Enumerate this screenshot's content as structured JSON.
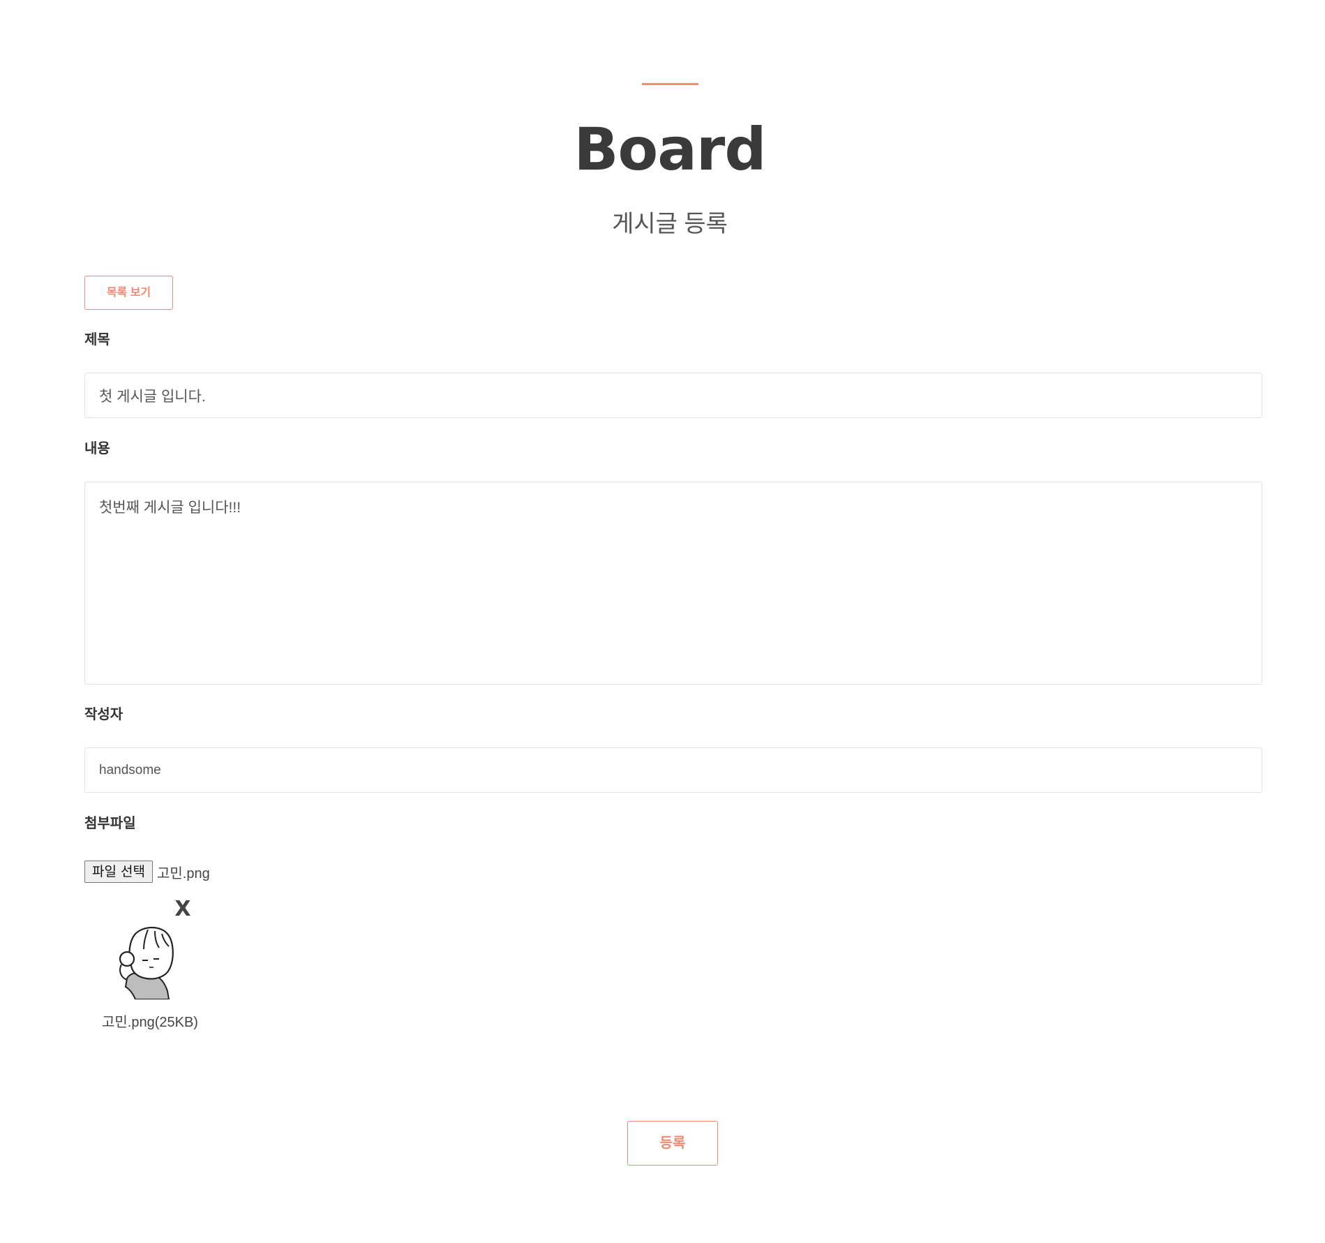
{
  "header": {
    "title": "Board",
    "subtitle": "게시글 등록"
  },
  "toolbar": {
    "list_button_label": "목록 보기"
  },
  "form": {
    "title_label": "제목",
    "title_value": "첫 게시글 입니다.",
    "content_label": "내용",
    "content_value": "첫번째 게시글 입니다!!!",
    "writer_label": "작성자",
    "writer_value": "handsome",
    "attachment_label": "첨부파일",
    "file_button_label": "파일 선택",
    "selected_file_name": "고민.png",
    "remove_label": "X",
    "preview_caption": "고민.png(25KB)",
    "submit_label": "등록"
  },
  "colors": {
    "accent": "#f08a73",
    "text": "#333333",
    "border": "#e3e3e3"
  }
}
